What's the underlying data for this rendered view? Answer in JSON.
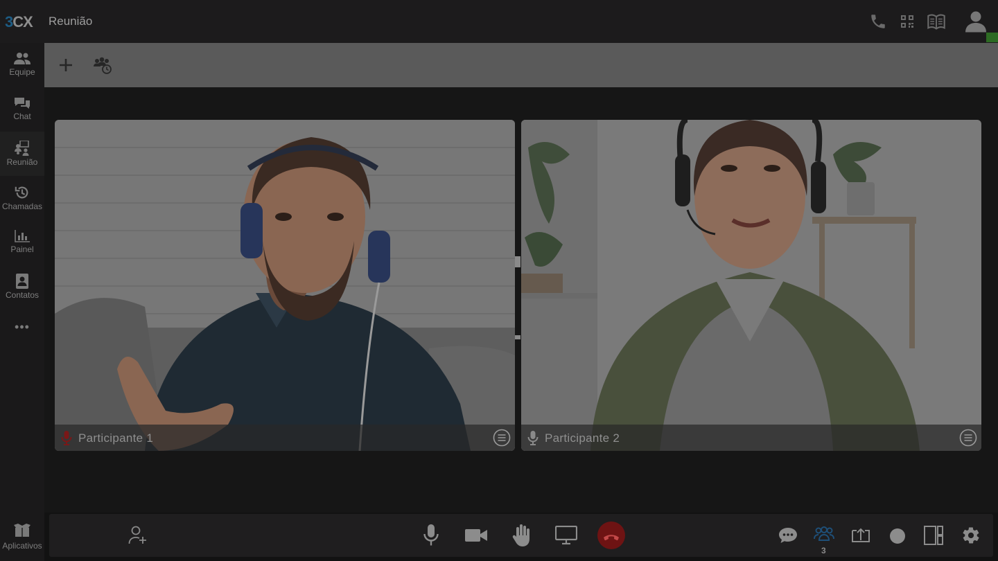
{
  "app": {
    "logo_a": "3",
    "logo_b": "CX",
    "title": "Reunião"
  },
  "sidebar": {
    "items": [
      {
        "label": "Equipe",
        "icon": "team-icon"
      },
      {
        "label": "Chat",
        "icon": "chat-icon"
      },
      {
        "label": "Reunião",
        "icon": "meeting-icon"
      },
      {
        "label": "Chamadas",
        "icon": "history-icon"
      },
      {
        "label": "Painel",
        "icon": "panel-chart-icon"
      },
      {
        "label": "Contatos",
        "icon": "contacts-icon"
      }
    ],
    "more": "•••",
    "apps_label": "Aplicativos"
  },
  "participants": [
    {
      "name": "Participante 1",
      "muted_color": "#7a1818"
    },
    {
      "name": "Participante 2",
      "muted_color": "#8a8a8a"
    }
  ],
  "controls": {
    "participant_count": "3",
    "hangup_color": "#6e1313",
    "accent_color": "#1e4f78"
  }
}
